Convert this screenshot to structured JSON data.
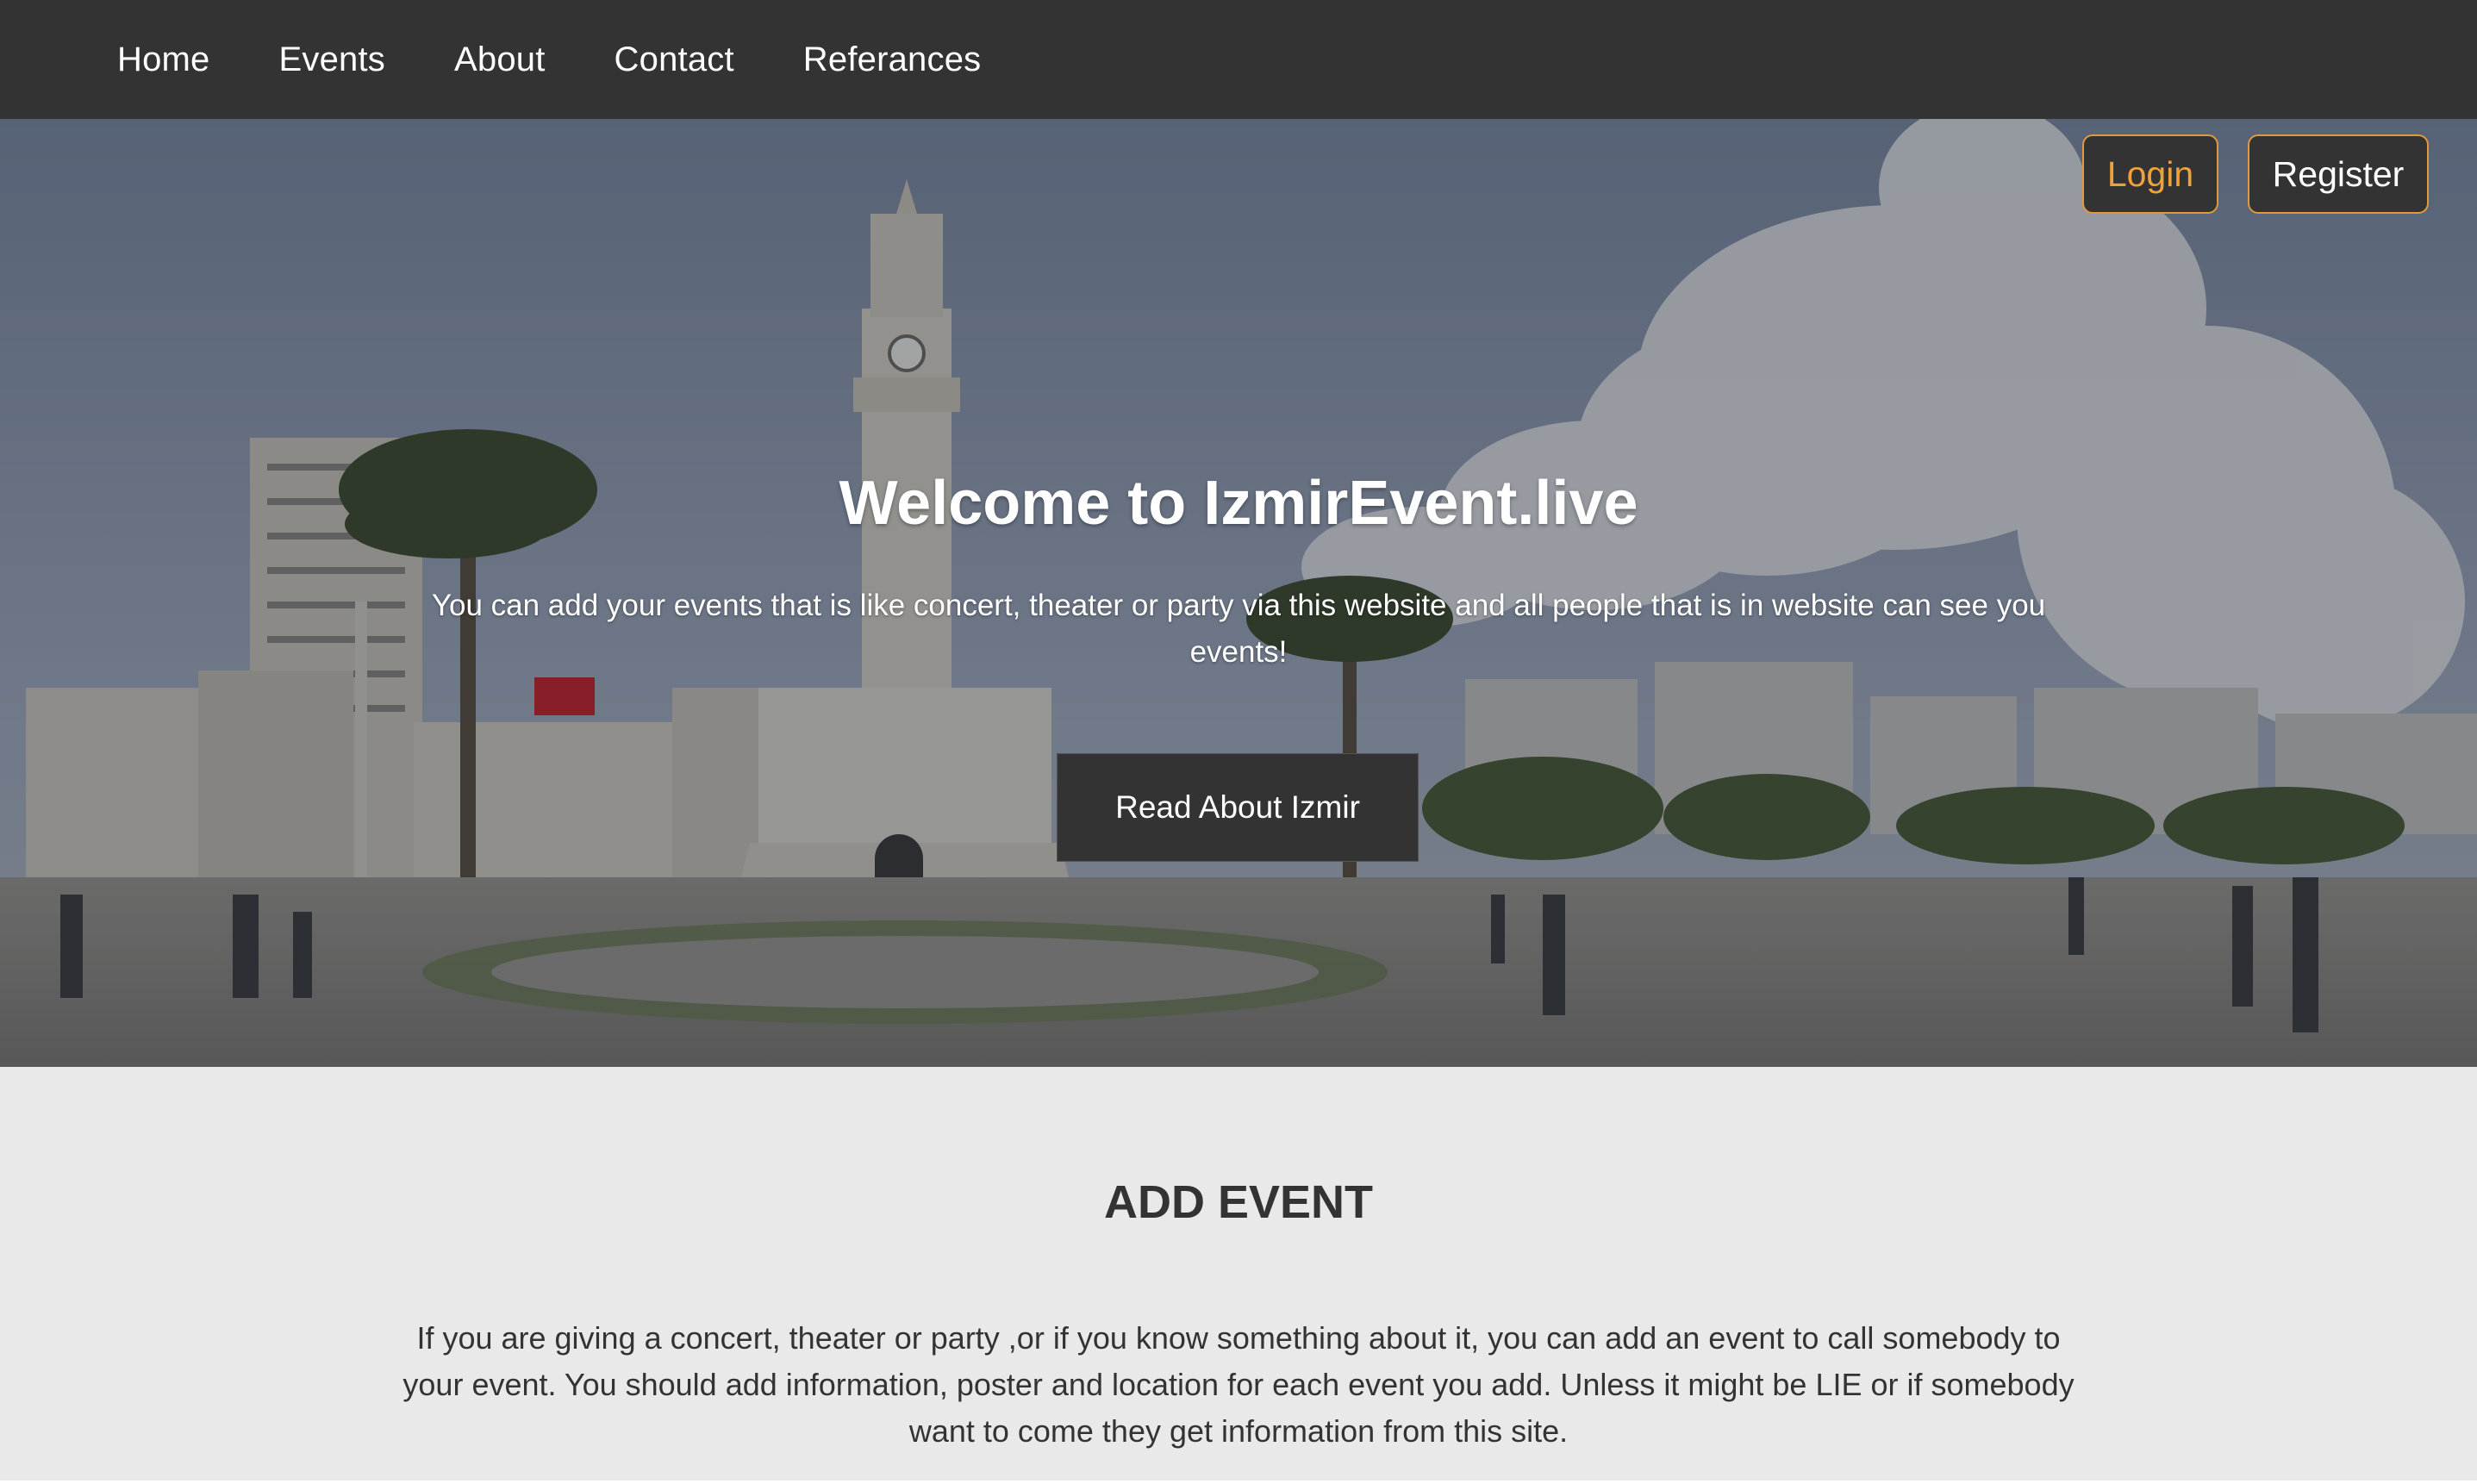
{
  "nav": {
    "items": [
      {
        "label": "Home"
      },
      {
        "label": "Events"
      },
      {
        "label": "About"
      },
      {
        "label": "Contact"
      },
      {
        "label": "Referances"
      }
    ]
  },
  "auth": {
    "login_label": "Login",
    "register_label": "Register"
  },
  "hero": {
    "title": "Welcome to IzmirEvent.live",
    "subtitle": "You can add your events that is like concert, theater or party via this website and all people that is in website can see you events!",
    "cta_label": "Read About Izmir",
    "background_image": "izmir-clock-tower-square-photo"
  },
  "add_event": {
    "title": "ADD EVENT",
    "text": "If you are giving a concert, theater or party ,or if you know something about it, you can add an event to call somebody to your event. You should add information, poster and location for each event you add. Unless it might be LIE or if somebody want to come they get information from this site."
  },
  "colors": {
    "navbar_bg": "#333333",
    "accent": "#e09a3c",
    "login_text": "#f0a23a",
    "section_bg": "#e9e9e9",
    "text_dark": "#333333"
  }
}
